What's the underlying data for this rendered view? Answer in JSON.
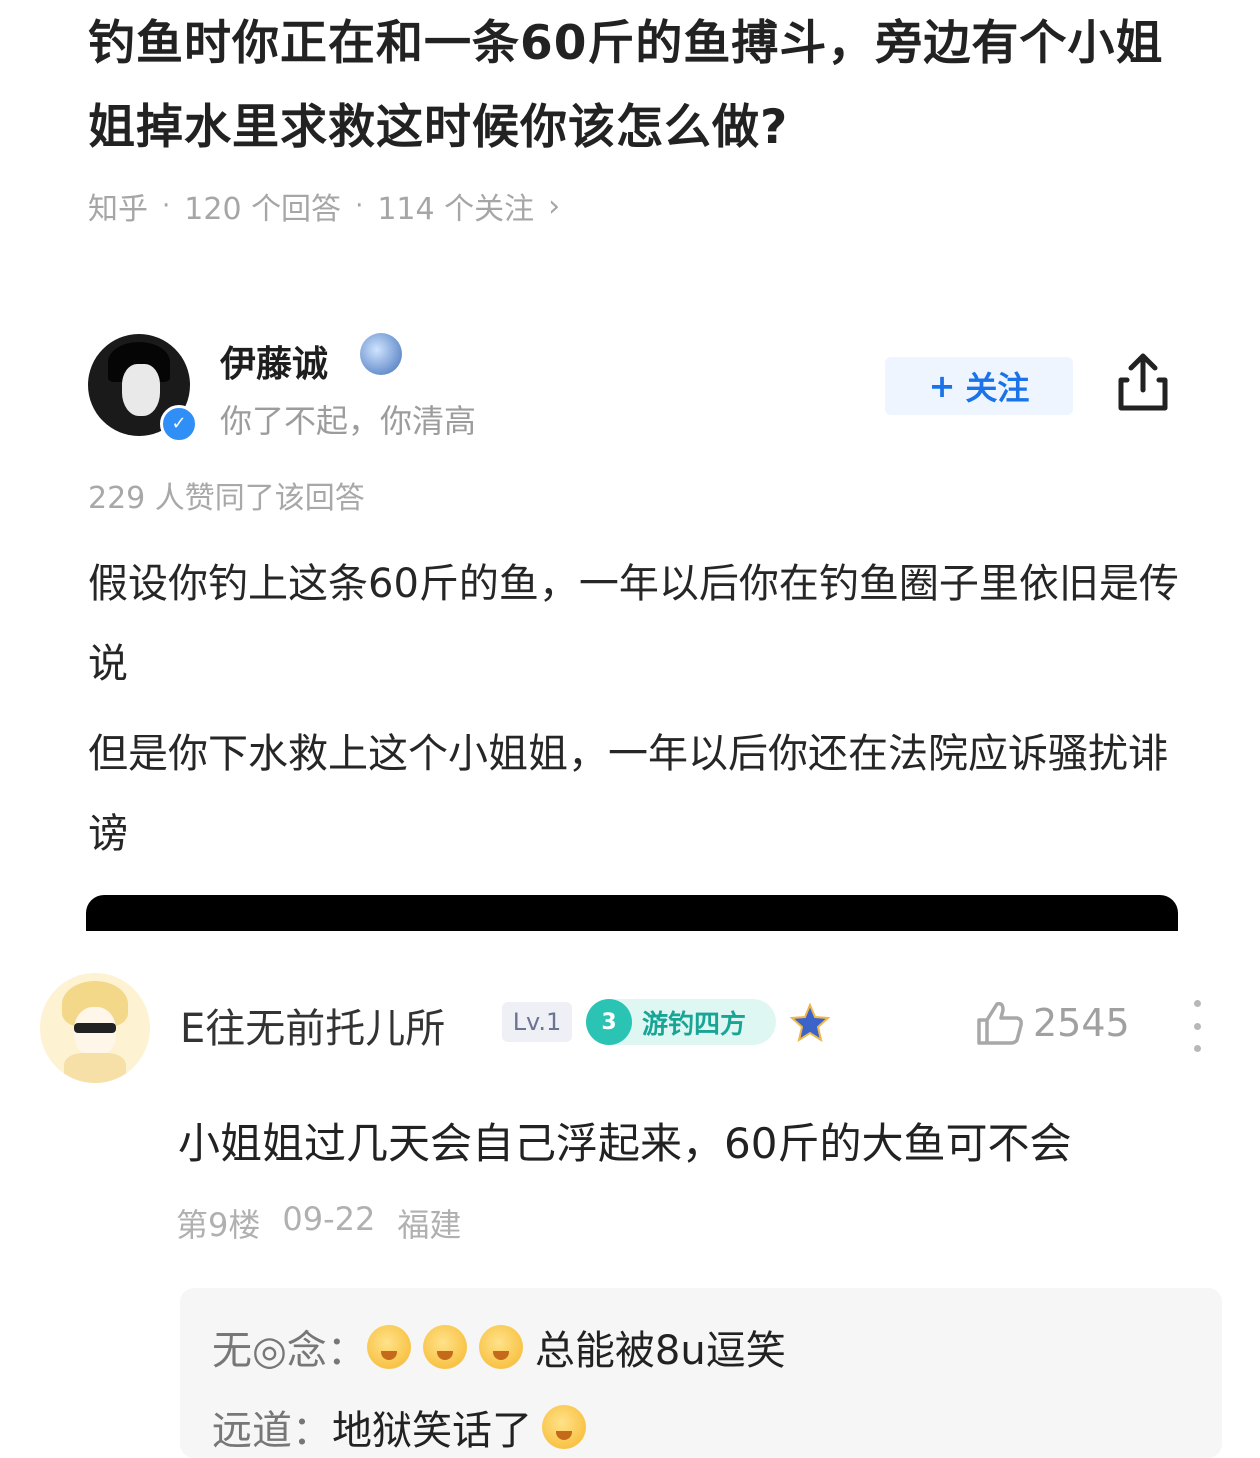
{
  "question": {
    "title": "钓鱼时你正在和一条60斤的鱼搏斗，旁边有个小姐姐掉水里求救这时候你该怎么做?",
    "source": "知乎",
    "answers": "120 个回答",
    "followers": "114 个关注",
    "chevron": "›"
  },
  "answer": {
    "author": "伊藤诚",
    "signature": "你了不起，你清高",
    "follow_label": "关注",
    "follow_plus": "+",
    "upvotes": "229 人赞同了该回答",
    "paragraphs": [
      "假设你钓上这条60斤的鱼，一年以后你在钓鱼圈子里依旧是传说",
      "但是你下水救上这个小姐姐，一年以后你还在法院应诉骚扰诽谤"
    ]
  },
  "comment": {
    "username": "E往无前托儿所",
    "level": "Lv.1",
    "badge_num": "3",
    "badge_text": "游钓四方",
    "likes": "2545",
    "text": "小姐姐过几天会自己浮起来，60斤的大鱼可不会",
    "floor": "第9楼",
    "date": "09-22",
    "location": "福建"
  },
  "replies": [
    {
      "name": "无◎念：",
      "emojis": 3,
      "text": "总能被8u逗笑"
    },
    {
      "name": "远道：",
      "emojis": 1,
      "text": "地狱笑话了"
    }
  ],
  "icons": {
    "share": "share-icon",
    "like": "thumbs-up-icon",
    "more": "more-vertical-icon",
    "verify": "verified-icon"
  },
  "colors": {
    "accent": "#1a73e8",
    "badge": "#2bc4b4",
    "meta": "#a6a6a6"
  }
}
